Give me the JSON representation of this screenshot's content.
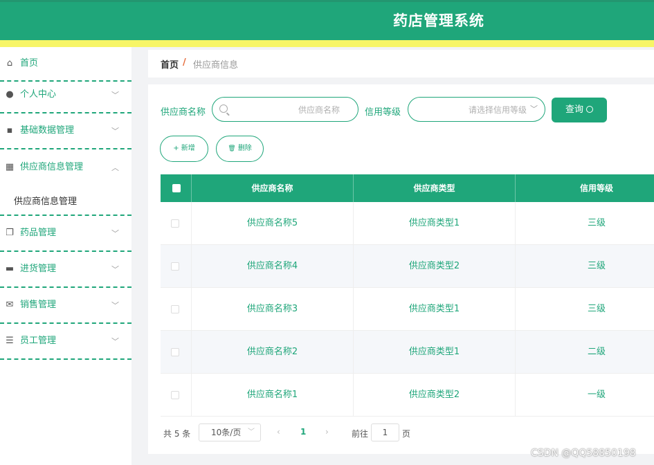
{
  "header": {
    "title": "药店管理系统"
  },
  "sidebar": {
    "items": [
      {
        "label": "首页",
        "icon": "home-icon",
        "glyph": "⌂",
        "expandable": false
      },
      {
        "label": "个人中心",
        "icon": "user-icon",
        "glyph": "●",
        "expandable": true
      },
      {
        "label": "基础数据管理",
        "icon": "database-icon",
        "glyph": "▪",
        "expandable": true
      },
      {
        "label": "供应商信息管理",
        "icon": "grid-icon",
        "glyph": "▦",
        "expandable": true,
        "expanded": true
      },
      {
        "label": "药品管理",
        "icon": "copy-icon",
        "glyph": "❐",
        "expandable": true
      },
      {
        "label": "进货管理",
        "icon": "chat-icon",
        "glyph": "▬",
        "expandable": true
      },
      {
        "label": "销售管理",
        "icon": "mail-icon",
        "glyph": "✉",
        "expandable": true
      },
      {
        "label": "员工管理",
        "icon": "sliders-icon",
        "glyph": "☰",
        "expandable": true
      }
    ],
    "submenu_label": "供应商信息管理",
    "chevron_down": "﹀",
    "chevron_up": "︿"
  },
  "breadcrumb": {
    "home": "首页",
    "separator": "/",
    "current": "供应商信息"
  },
  "search": {
    "name_label": "供应商名称",
    "name_placeholder": "供应商名称",
    "level_label": "信用等级",
    "level_placeholder": "请选择信用等级",
    "query_label": "查询"
  },
  "actions": {
    "add_label": "新增",
    "add_glyph": "+",
    "delete_label": "删除",
    "delete_glyph": "🗑"
  },
  "table": {
    "columns": [
      "供应商名称",
      "供应商类型",
      "信用等级"
    ],
    "rows": [
      [
        "供应商名称5",
        "供应商类型1",
        "三级"
      ],
      [
        "供应商名称4",
        "供应商类型2",
        "三级"
      ],
      [
        "供应商名称3",
        "供应商类型1",
        "三级"
      ],
      [
        "供应商名称2",
        "供应商类型1",
        "二级"
      ],
      [
        "供应商名称1",
        "供应商类型2",
        "一级"
      ]
    ]
  },
  "pagination": {
    "total": "共 5 条",
    "page_size": "10条/页",
    "current_page": "1",
    "goto_label": "前往",
    "goto_value": "1",
    "page_suffix": "页",
    "prev_glyph": "‹",
    "next_glyph": "›"
  },
  "watermark": "CSDN @QQ58850198",
  "colors": {
    "primary": "#1fa67a",
    "accent_yellow": "#f7f567",
    "breadcrumb_sep": "#e66b3a"
  }
}
